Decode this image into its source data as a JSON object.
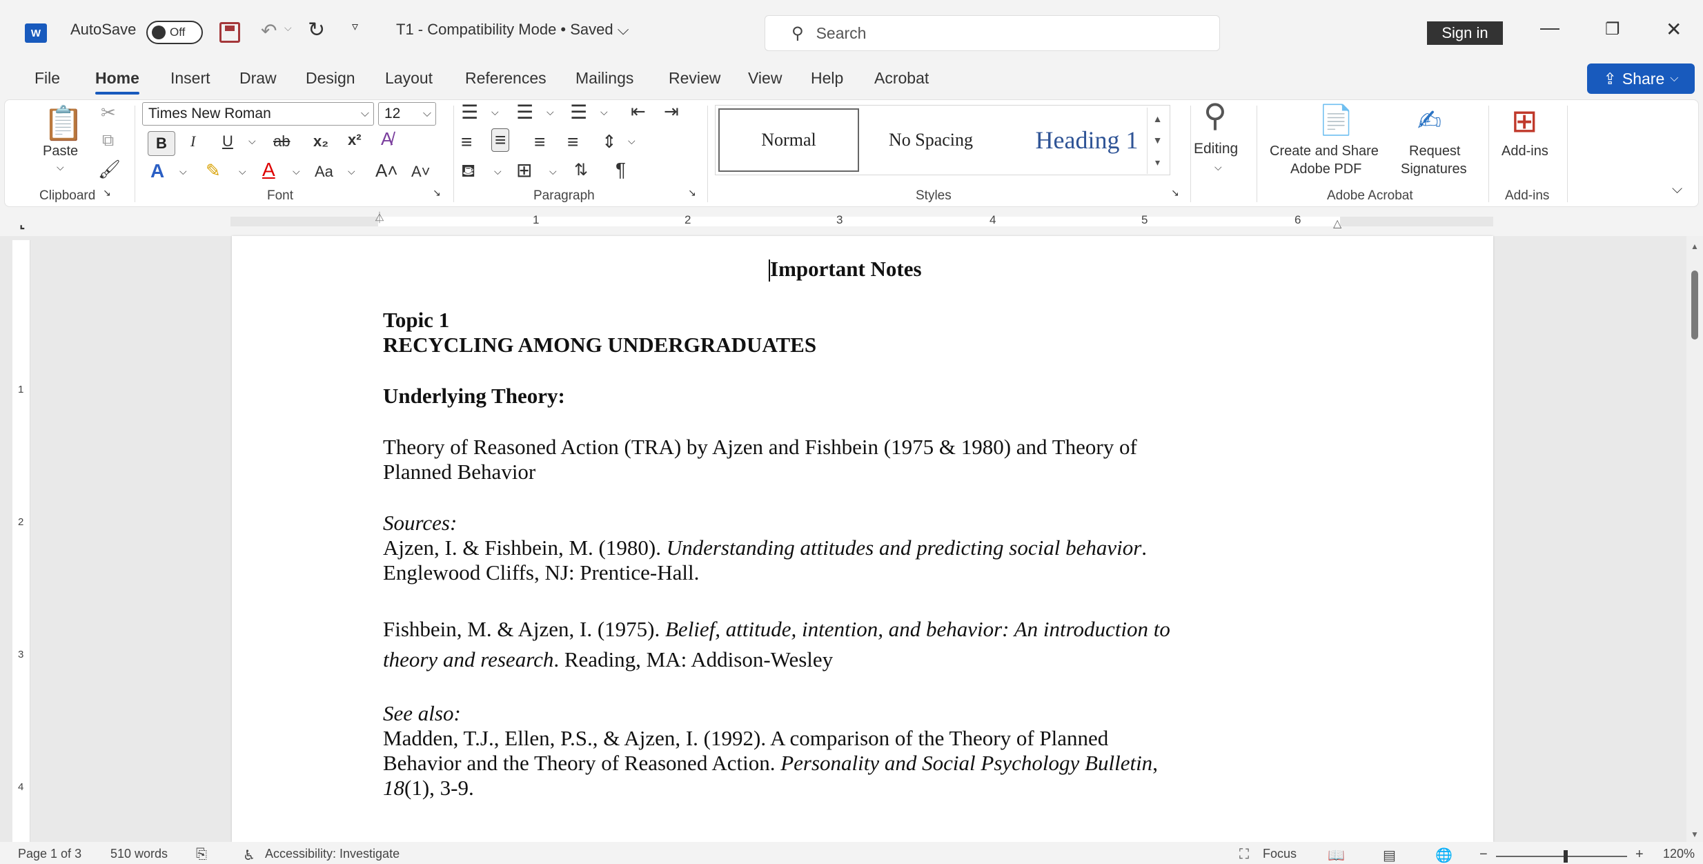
{
  "titlebar": {
    "app_icon": "W",
    "autosave_label": "AutoSave",
    "autosave_state": "Off",
    "document_title": "T1 - Compatibility Mode • Saved ⌵",
    "search_placeholder": "Search",
    "signin_label": "Sign in"
  },
  "menu": {
    "tabs": [
      "File",
      "Home",
      "Insert",
      "Draw",
      "Design",
      "Layout",
      "References",
      "Mailings",
      "Review",
      "View",
      "Help",
      "Acrobat"
    ],
    "active_tab": "Home",
    "share_label": "Share"
  },
  "ribbon": {
    "clipboard": {
      "paste_label": "Paste",
      "group_label": "Clipboard"
    },
    "font": {
      "font_name": "Times New Roman",
      "font_size": "12",
      "bold_label": "B",
      "italic_label": "I",
      "underline_label": "U",
      "strike_label": "ab",
      "subscript_label": "x₂",
      "superscript_label": "x²",
      "case_label": "Aa",
      "grow_label": "A˄",
      "shrink_label": "A˅",
      "group_label": "Font"
    },
    "paragraph": {
      "group_label": "Paragraph"
    },
    "styles": {
      "normal": "Normal",
      "no_spacing": "No Spacing",
      "heading1": "Heading 1",
      "group_label": "Styles"
    },
    "editing": {
      "label": "Editing"
    },
    "acrobat": {
      "create_share_line1": "Create and Share",
      "create_share_line2": "Adobe PDF",
      "request_line1": "Request",
      "request_line2": "Signatures",
      "group_label": "Adobe Acrobat"
    },
    "addins": {
      "label": "Add-ins",
      "group_label": "Add-ins"
    }
  },
  "ruler": {
    "numbers": [
      "1",
      "2",
      "3",
      "4",
      "5",
      "6"
    ],
    "vertical_numbers": [
      "1",
      "2",
      "3",
      "4"
    ]
  },
  "document": {
    "title": "Important Notes",
    "topic": "Topic 1",
    "topic_heading": "RECYCLING AMONG UNDERGRADUATES",
    "theory_heading": "Underlying Theory:",
    "theory_line1": "Theory of Reasoned Action (TRA) by Ajzen and Fishbein (1975 & 1980) and Theory of",
    "theory_line2": "Planned Behavior",
    "sources_label": "Sources:",
    "ref1_part1": "Ajzen, I. & Fishbein, M. (1980). ",
    "ref1_title": "Understanding attitudes and predicting social behavior",
    "ref1_part2": ".",
    "ref1_line2": "Englewood Cliffs, NJ: Prentice-Hall.",
    "ref2_part1": "Fishbein, M. & Ajzen, I. (1975). ",
    "ref2_title_a": "Belief, attitude, intention, and behavior: An introduction to",
    "ref2_title_b": "theory and research",
    "ref2_part2": ". Reading, MA: Addison-Wesley",
    "see_also_label": "See also:",
    "ref3_line1": "Madden, T.J., Ellen, P.S., & Ajzen, I. (1992). A comparison of the Theory of Planned",
    "ref3_line2_a": "Behavior and the Theory of Reasoned Action. ",
    "ref3_journal": "Personality and Social Psychology Bulletin",
    "ref3_line2_b": ",",
    "ref3_volume": "18",
    "ref3_line3": "(1), 3-9."
  },
  "statusbar": {
    "page": "Page 1 of 3",
    "words": "510 words",
    "accessibility": "Accessibility: Investigate",
    "focus": "Focus",
    "zoom": "120%"
  }
}
